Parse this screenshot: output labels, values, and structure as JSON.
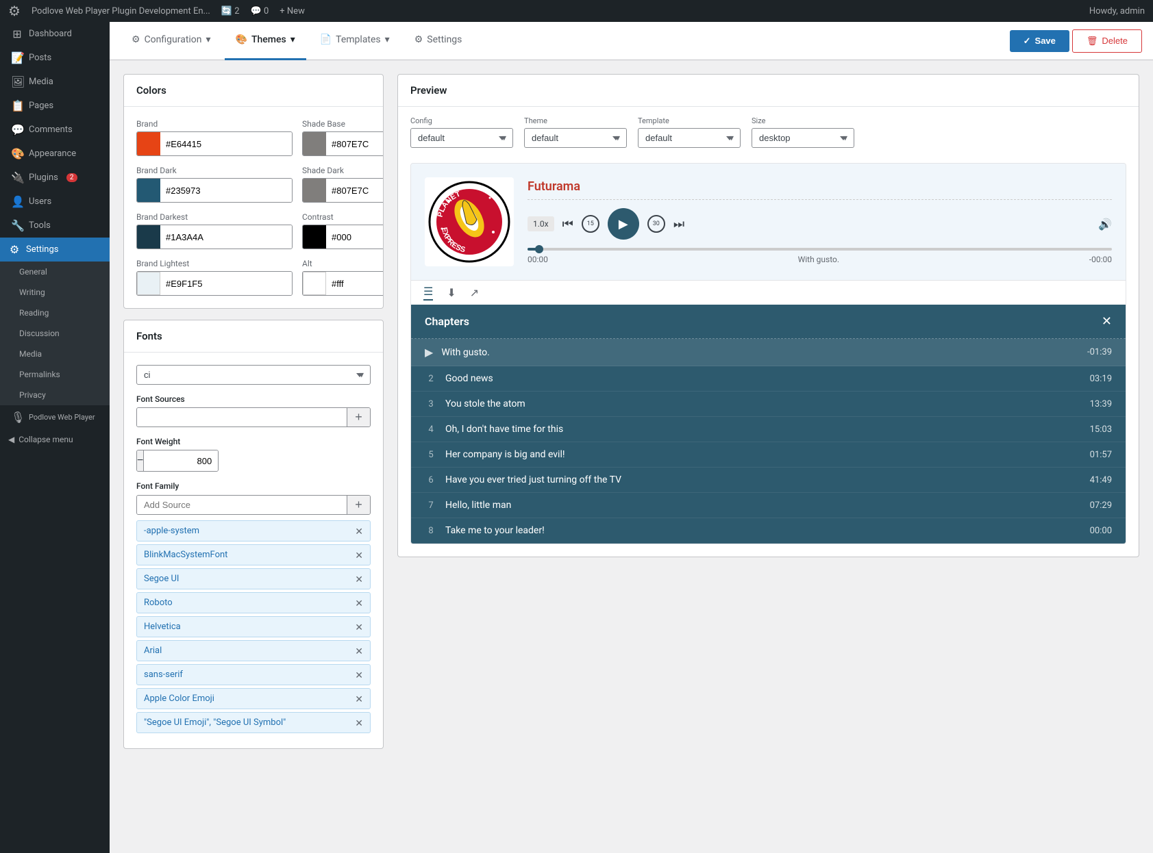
{
  "adminBar": {
    "siteName": "Podlove Web Player Plugin Development En...",
    "updates": "2",
    "comments": "0",
    "newLabel": "+ New",
    "howdy": "Howdy, admin"
  },
  "sidebar": {
    "items": [
      {
        "id": "dashboard",
        "label": "Dashboard",
        "icon": "⊞"
      },
      {
        "id": "posts",
        "label": "Posts",
        "icon": "📄"
      },
      {
        "id": "media",
        "label": "Media",
        "icon": "🖼"
      },
      {
        "id": "pages",
        "label": "Pages",
        "icon": "📋"
      },
      {
        "id": "comments",
        "label": "Comments",
        "icon": "💬"
      },
      {
        "id": "appearance",
        "label": "Appearance",
        "icon": "🎨"
      },
      {
        "id": "plugins",
        "label": "Plugins",
        "icon": "🔌",
        "badge": "2"
      },
      {
        "id": "users",
        "label": "Users",
        "icon": "👤"
      },
      {
        "id": "tools",
        "label": "Tools",
        "icon": "🔧"
      },
      {
        "id": "settings",
        "label": "Settings",
        "icon": "⚙"
      },
      {
        "id": "podlove",
        "label": "Podlove Web Player",
        "icon": ""
      }
    ],
    "settingsSubmenu": [
      {
        "id": "general",
        "label": "General"
      },
      {
        "id": "writing",
        "label": "Writing"
      },
      {
        "id": "reading",
        "label": "Reading"
      },
      {
        "id": "discussion",
        "label": "Discussion"
      },
      {
        "id": "media",
        "label": "Media"
      },
      {
        "id": "permalinks",
        "label": "Permalinks"
      },
      {
        "id": "privacy",
        "label": "Privacy"
      }
    ],
    "collapseLabel": "Collapse menu"
  },
  "topNav": {
    "tabs": [
      {
        "id": "configuration",
        "label": "Configuration",
        "icon": "⚙"
      },
      {
        "id": "themes",
        "label": "Themes",
        "icon": ""
      },
      {
        "id": "templates",
        "label": "Templates",
        "icon": "📄"
      },
      {
        "id": "settings",
        "label": "Settings",
        "icon": "⚙"
      }
    ],
    "activeTab": "themes",
    "saveLabel": "Save",
    "deleteLabel": "Delete"
  },
  "colorsCard": {
    "title": "Colors",
    "fields": [
      {
        "id": "brand",
        "label": "Brand",
        "value": "#E64415",
        "swatchColor": "#E64415"
      },
      {
        "id": "shadeBase",
        "label": "Shade Base",
        "value": "#807E7C",
        "swatchColor": "#807E7C"
      },
      {
        "id": "brandDark",
        "label": "Brand Dark",
        "value": "#235973",
        "swatchColor": "#235973"
      },
      {
        "id": "shadeDark",
        "label": "Shade Dark",
        "value": "#807E7C",
        "swatchColor": "#807E7C"
      },
      {
        "id": "brandDarkest",
        "label": "Brand Darkest",
        "value": "#1A3A4A",
        "swatchColor": "#1A3A4A"
      },
      {
        "id": "contrast",
        "label": "Contrast",
        "value": "#000",
        "swatchColor": "#000"
      },
      {
        "id": "brandLightest",
        "label": "Brand Lightest",
        "value": "#E9F1F5",
        "swatchColor": "#E9F1F5"
      },
      {
        "id": "alt",
        "label": "Alt",
        "value": "#fff",
        "swatchColor": "#fff"
      }
    ]
  },
  "fontsCard": {
    "title": "Fonts",
    "selectValue": "ci",
    "fontSourcesLabel": "Font Sources",
    "fontSourcePlaceholder": "",
    "fontWeightLabel": "Font Weight",
    "fontWeightValue": "800",
    "fontFamilyLabel": "Font Family",
    "addSourcePlaceholder": "Add Source",
    "fontList": [
      {
        "name": "-apple-system"
      },
      {
        "name": "BlinkMacSystemFont"
      },
      {
        "name": "Segoe UI"
      },
      {
        "name": "Roboto"
      },
      {
        "name": "Helvetica"
      },
      {
        "name": "Arial"
      },
      {
        "name": "sans-serif"
      },
      {
        "name": "Apple Color Emoji"
      },
      {
        "name": "\"Segoe UI Emoji\", \"Segoe UI Symbol\""
      }
    ]
  },
  "preview": {
    "title": "Preview",
    "configLabel": "Config",
    "configValue": "default",
    "themeLabel": "Theme",
    "themeValue": "default",
    "templateLabel": "Template",
    "templateValue": "default",
    "sizeLabel": "Size",
    "sizeValue": "desktop"
  },
  "player": {
    "podcastName": "Futurama",
    "currentTime": "00:00",
    "totalTime": "-00:00",
    "progress": 2,
    "chapterLabel": "With gusto.",
    "speed": "1.0x"
  },
  "chapters": {
    "title": "Chapters",
    "items": [
      {
        "num": "",
        "name": "With gusto.",
        "time": "-01:39",
        "active": true
      },
      {
        "num": "2",
        "name": "Good news",
        "time": "03:19",
        "active": false
      },
      {
        "num": "3",
        "name": "You stole the atom",
        "time": "13:39",
        "active": false
      },
      {
        "num": "4",
        "name": "Oh, I don't have time for this",
        "time": "15:03",
        "active": false
      },
      {
        "num": "5",
        "name": "Her company is big and evil!",
        "time": "01:57",
        "active": false
      },
      {
        "num": "6",
        "name": "Have you ever tried just turning off the TV",
        "time": "41:49",
        "active": false
      },
      {
        "num": "7",
        "name": "Hello, little man",
        "time": "07:29",
        "active": false
      },
      {
        "num": "8",
        "name": "Take me to your leader!",
        "time": "00:00",
        "active": false
      }
    ]
  }
}
